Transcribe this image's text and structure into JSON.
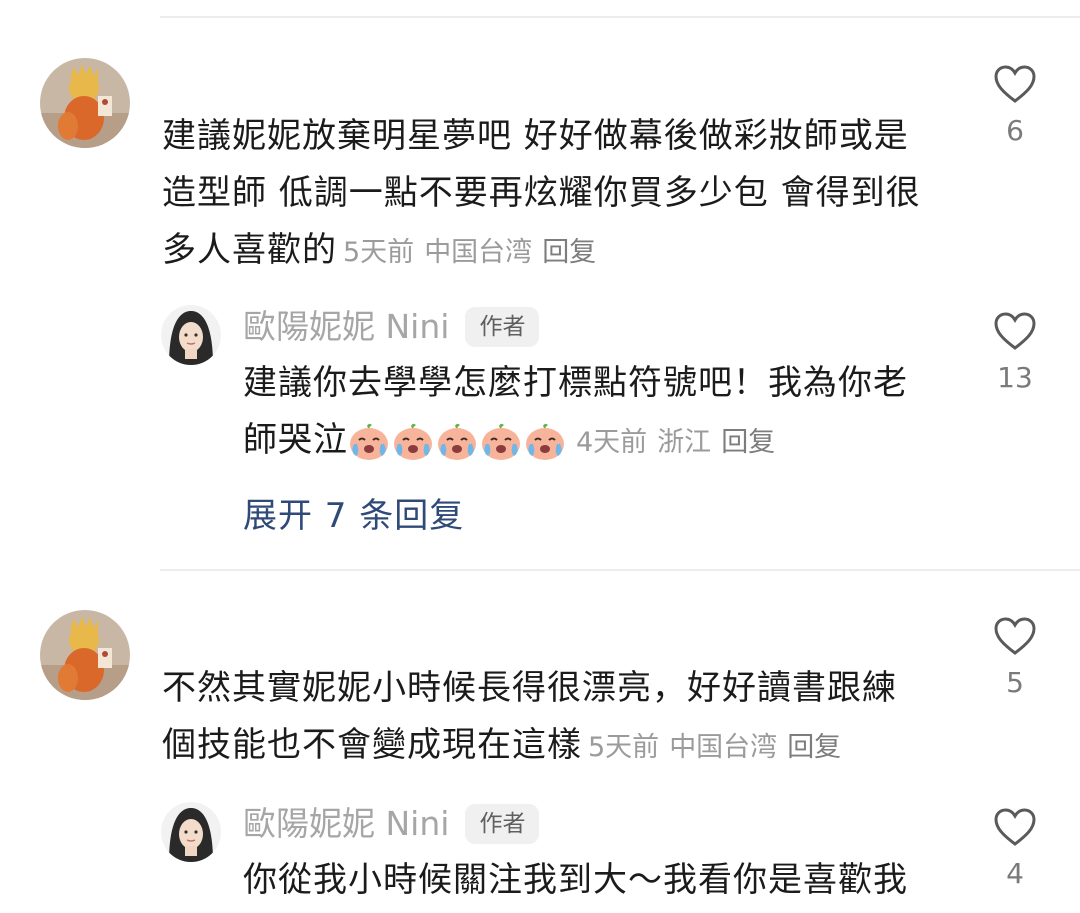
{
  "comments": [
    {
      "avatar": "cartoon-figure-avatar",
      "text_lines": [
        "建議妮妮放棄明星夢吧 好好做幕後做彩妝師或是",
        "造型師 低調一點不要再炫耀你買多少包 會得到很",
        "多人喜歡的"
      ],
      "time": "5天前",
      "location": "中国台湾",
      "reply_label": "回复",
      "likes": "6",
      "reply": {
        "user": "歐陽妮妮 Nini",
        "badge": "作者",
        "text_lines": [
          "建議你去學學怎麼打標點符號吧！我為你老",
          "師哭泣"
        ],
        "emoji": [
          "crying-face",
          "crying-face",
          "crying-face",
          "crying-face",
          "crying-face"
        ],
        "time": "4天前",
        "location": "浙江",
        "reply_label": "回复",
        "likes": "13"
      },
      "expand_label": "展开 7 条回复"
    },
    {
      "avatar": "cartoon-figure-avatar",
      "text_lines": [
        "不然其實妮妮小時候長得很漂亮，好好讀書跟練",
        "個技能也不會變成現在這樣"
      ],
      "time": "5天前",
      "location": "中国台湾",
      "reply_label": "回复",
      "likes": "5",
      "reply": {
        "user": "歐陽妮妮 Nini",
        "badge": "作者",
        "text_lines": [
          "你從我小時候關注我到大～我看你是喜歡我"
        ],
        "likes": "4"
      }
    }
  ],
  "colors": {
    "link": "#2f4a78",
    "meta": "#9b9b9b",
    "divider": "#ececec"
  }
}
